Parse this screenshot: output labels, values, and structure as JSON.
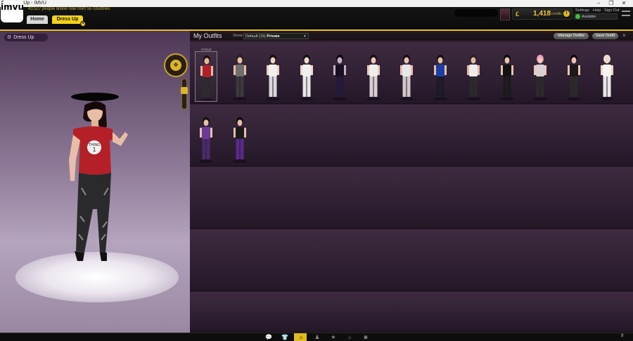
{
  "window": {
    "title": "Dress Up - IMVU",
    "controls": [
      "–",
      "❐",
      "✕"
    ]
  },
  "header": {
    "logo_text": "imvu",
    "online_text": "43,527 people online now from 55 countries",
    "tabs": [
      {
        "label": "Home",
        "active": false
      },
      {
        "label": "Dress Up",
        "active": true
      }
    ],
    "tab_close": "×",
    "credits": {
      "icon": "£",
      "value": "1,418",
      "label": "credits"
    },
    "links": [
      "Settings",
      "Help",
      "Sign Out"
    ],
    "status": "Available",
    "accent_color": "#e6c21d"
  },
  "stage": {
    "label": "Dress Up",
    "gear_icon": "gear-icon",
    "cam_icon": "camera-control-icon"
  },
  "outfits": {
    "title": "My Outfits",
    "show_label": "Show",
    "filter": {
      "prefix": "Default (15)",
      "value": "Private"
    },
    "manage_button": "Manage Outfits",
    "save_button": "Save Outfit",
    "close": "×",
    "default_label": "Default",
    "items": [
      {
        "top": "#b0202a",
        "bottom": "#2b2b2b",
        "hair": "#1a1010",
        "skin": "#e8b89a"
      },
      {
        "top": "#6e6e6e",
        "bottom": "#3a3a3a",
        "hair": "#222",
        "skin": "#e8c0a8"
      },
      {
        "top": "#f0f0f0",
        "bottom": "#d8d8d8",
        "hair": "#111",
        "skin": "#f0d0c0"
      },
      {
        "top": "#efefef",
        "bottom": "#e6e6e6",
        "hair": "#111",
        "skin": "#f2d8cc"
      },
      {
        "top": "#1a1024",
        "bottom": "#24183a",
        "hair": "#0a0a0a",
        "skin": "#c8b0c8"
      },
      {
        "top": "#eeeeee",
        "bottom": "#d8d0d0",
        "hair": "#111",
        "skin": "#f0c8b8"
      },
      {
        "top": "#e8e8e8",
        "bottom": "#d0c8c8",
        "hair": "#111",
        "skin": "#eebfae"
      },
      {
        "top": "#1a3fa8",
        "bottom": "#1a1a2a",
        "hair": "#111",
        "skin": "#e8c0a8"
      },
      {
        "top": "#ededed",
        "bottom": "#2a2a2a",
        "hair": "#222",
        "skin": "#e6b8a0"
      },
      {
        "top": "#121212",
        "bottom": "#1a1a1a",
        "hair": "#0a0a0a",
        "skin": "#e8c4b0"
      },
      {
        "top": "#d9d0d4",
        "bottom": "#2a2a2a",
        "hair": "#f29ab4",
        "skin": "#f0c8b8"
      },
      {
        "top": "#1a1a1a",
        "bottom": "#2a2a2a",
        "hair": "#0a0a0a",
        "skin": "#eec4b0"
      },
      {
        "top": "#f4f4f4",
        "bottom": "#e8e8e8",
        "hair": "#e8e0d4",
        "skin": "#f2d4c4"
      },
      {
        "top": "#6a3a9a",
        "bottom": "#4a2a6a",
        "hair": "#111",
        "skin": "#e8c0a8"
      },
      {
        "top": "#1a1a1a",
        "bottom": "#5a2a8a",
        "hair": "#0a0a0a",
        "skin": "#e6bea8"
      }
    ]
  },
  "taskbar": {
    "icons": [
      "chat-icon",
      "shirt-icon",
      "hanger-icon",
      "people-icon",
      "star-icon",
      "rooms-icon",
      "camera-icon"
    ],
    "active_index": 2,
    "count": "9"
  }
}
